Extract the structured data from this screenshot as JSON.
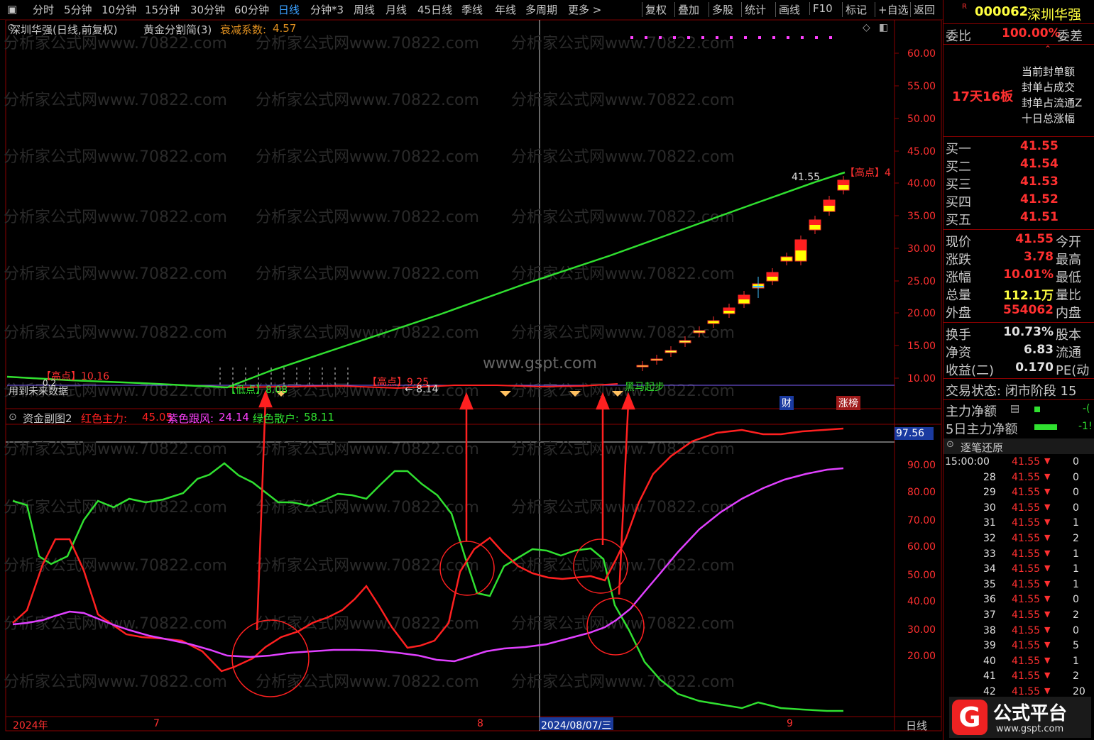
{
  "toolbar": {
    "left_items": [
      "分时",
      "5分钟",
      "10分钟",
      "15分钟",
      "30分钟",
      "60分钟",
      "日线",
      "分钟*3",
      "周线",
      "月线",
      "45日线",
      "季线",
      "年线",
      "多周期",
      "更多 >"
    ],
    "active_item": "日线",
    "right_items": [
      "复权",
      "叠加",
      "多股",
      "统计",
      "画线",
      "F10",
      "标记",
      "+自选",
      "返回"
    ]
  },
  "main_chart": {
    "title": "深圳华强(日线,前复权)",
    "indicator": "黄金分割简(3)",
    "decay_label": "衰减系数:",
    "decay_value": "4.57",
    "y_ticks": [
      "60.00",
      "55.00",
      "50.00",
      "45.00",
      "40.00",
      "35.00",
      "30.00",
      "25.00",
      "20.00",
      "15.00",
      "10.00"
    ],
    "annotations": {
      "high_1": "【高点】10.16",
      "low_1": "【低点】8.08",
      "high_2": "【高点】9.25",
      "arrow_val": "← 8.14",
      "high_last": "【高点】4",
      "last_price": "41.55",
      "dark_horse": "黑马起步",
      "future_data": "用到未来数据",
      "fin_badge": "财",
      "limit_badge": "涨榜",
      "watermark_center": "www.gspt.com",
      "small_0": "0.2"
    }
  },
  "sub_chart": {
    "title": "资金副图2",
    "red_label": "红色主力:",
    "red_value": "45.05",
    "purple_label": "紫色跟风:",
    "purple_value": "24.14",
    "green_label": "绿色散户:",
    "green_value": "58.11",
    "crosshair_value": "97.56",
    "y_ticks": [
      "90.00",
      "80.00",
      "70.00",
      "60.00",
      "50.00",
      "40.00",
      "30.00",
      "20.00"
    ]
  },
  "x_axis": {
    "labels": [
      "2024年",
      "7",
      "8",
      "2024/08/07/三",
      "9"
    ],
    "period": "日线"
  },
  "watermark": "分析家公式网www.70822.com",
  "quote_panel": {
    "code_badge": "R",
    "code": "000062",
    "name": "深圳华强",
    "weibi_label": "委比",
    "weibi_value": "100.00%",
    "weicha_label": "委差",
    "board_streak": "17天16板",
    "seal_items": [
      "当前封单额",
      "封单占成交",
      "封单占流通Z",
      "十日总涨幅"
    ],
    "bids": [
      {
        "label": "买一",
        "price": "41.55"
      },
      {
        "label": "买二",
        "price": "41.54"
      },
      {
        "label": "买三",
        "price": "41.53"
      },
      {
        "label": "买四",
        "price": "41.52"
      },
      {
        "label": "买五",
        "price": "41.51"
      }
    ],
    "stats": [
      {
        "label": "现价",
        "value": "41.55",
        "right": "今开",
        "color": "red"
      },
      {
        "label": "涨跌",
        "value": "3.78",
        "right": "最高",
        "color": "red"
      },
      {
        "label": "涨幅",
        "value": "10.01%",
        "right": "最低",
        "color": "red"
      },
      {
        "label": "总量",
        "value": "112.1万",
        "right": "量比",
        "color": "yellow"
      },
      {
        "label": "外盘",
        "value": "554062",
        "right": "内盘",
        "color": "red"
      }
    ],
    "fund": [
      {
        "label": "换手",
        "value": "10.73%",
        "right": "股本"
      },
      {
        "label": "净资",
        "value": "6.83",
        "right": "流通"
      },
      {
        "label": "收益(二)",
        "value": "0.170",
        "right": "PE(动"
      }
    ],
    "trade_status": "交易状态: 闭市阶段 15",
    "main_net": "主力净额",
    "main_net_5d": "5日主力净额",
    "main_net_val": "-(",
    "main_net_5d_val": "-1!",
    "ticks_title": "逐笔还原",
    "ticks": [
      {
        "t": "15:00:00",
        "p": "41.55",
        "v": "0"
      },
      {
        "t": "28",
        "p": "41.55",
        "v": "0"
      },
      {
        "t": "29",
        "p": "41.55",
        "v": "0"
      },
      {
        "t": "30",
        "p": "41.55",
        "v": "0"
      },
      {
        "t": "31",
        "p": "41.55",
        "v": "1"
      },
      {
        "t": "32",
        "p": "41.55",
        "v": "2"
      },
      {
        "t": "33",
        "p": "41.55",
        "v": "1"
      },
      {
        "t": "34",
        "p": "41.55",
        "v": "1"
      },
      {
        "t": "35",
        "p": "41.55",
        "v": "1"
      },
      {
        "t": "36",
        "p": "41.55",
        "v": "0"
      },
      {
        "t": "37",
        "p": "41.55",
        "v": "2"
      },
      {
        "t": "38",
        "p": "41.55",
        "v": "0"
      },
      {
        "t": "39",
        "p": "41.55",
        "v": "5"
      },
      {
        "t": "40",
        "p": "41.55",
        "v": "1"
      },
      {
        "t": "41",
        "p": "41.55",
        "v": "2"
      },
      {
        "t": "42",
        "p": "41.55",
        "v": "20"
      }
    ],
    "logo_text": "公式平台",
    "logo_url": "www.gspt.com"
  },
  "colors": {
    "red": "#ff2020",
    "green": "#30e030",
    "magenta": "#ff40ff",
    "yellow": "#ffff00",
    "grid": "#8a0000"
  }
}
